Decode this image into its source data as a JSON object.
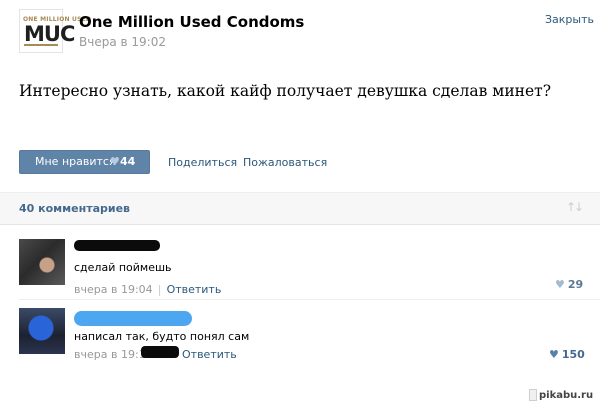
{
  "header": {
    "logo": {
      "top_text": "ONE MILLION USED",
      "main_text": "MUC"
    },
    "group_name": "One Million Used Condoms",
    "post_time": "Вчера в 19:02",
    "close_label": "Закрыть"
  },
  "post": {
    "text": "Интересно узнать, какой кайф получает девушка сделав минет?"
  },
  "actions": {
    "like_label": "Мне нравится",
    "like_icon": "heart-icon",
    "like_count": "44",
    "share_label": "Поделиться",
    "report_label": "Пожаловаться"
  },
  "comments_header": {
    "count_label": "40 комментариев",
    "sort_icon": "sort-arrows-icon"
  },
  "comments": [
    {
      "text": "сделай поймешь",
      "time": "вчера в 19:04",
      "separator": "|",
      "reply_label": "Ответить",
      "likes": "29",
      "like_color": "#a5b9d0"
    },
    {
      "text": "написал так, будто понял сам",
      "time": "вчера в 19:13",
      "reply_label": "Ответить",
      "likes": "150",
      "like_color": "#5b7fa6"
    }
  ],
  "watermark": "pikabu.ru",
  "colors": {
    "link": "#2b587a",
    "button": "#6083a8",
    "header_text": "#45688e",
    "muted": "#999999"
  }
}
